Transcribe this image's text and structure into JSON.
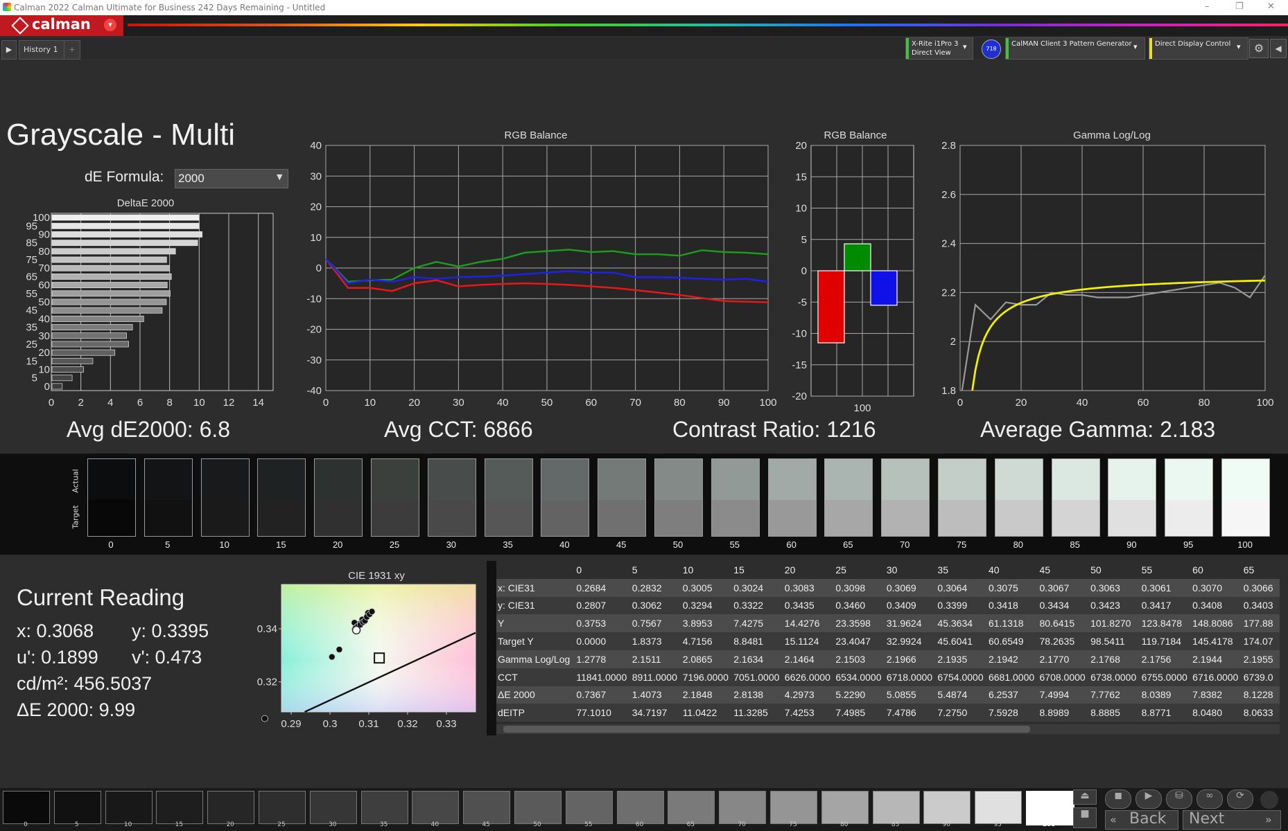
{
  "window": {
    "title": "Calman 2022 Calman Ultimate for Business 242 Days Remaining  - Untitled",
    "minimize": "–",
    "restore": "❐",
    "close": "✕"
  },
  "logo": {
    "text": "calman",
    "brand_color": "#c0191f"
  },
  "tabs": [
    {
      "label": "History 1"
    },
    {
      "label": "+"
    }
  ],
  "devices": [
    {
      "line1": "X-Rite i1Pro 3",
      "line2": "Direct View",
      "color": "#3ec43e"
    },
    {
      "badge": "718"
    },
    {
      "line1": "CalMAN Client 3 Pattern Generator",
      "line2": "",
      "color": "#3ec43e"
    },
    {
      "line1": "Direct Display Control",
      "line2": "",
      "color": "#e8e020"
    }
  ],
  "page": {
    "title": "Grayscale - Multi",
    "de_formula_label": "dE Formula:",
    "de_formula_value": "2000"
  },
  "stats": {
    "avg_de": "Avg dE2000: 6.8",
    "avg_cct": "Avg CCT: 6866",
    "contrast": "Contrast Ratio: 1216",
    "avg_gamma": "Average Gamma: 2.183"
  },
  "chart_data": [
    {
      "id": "deltae",
      "type": "bar",
      "title": "DeltaE 2000",
      "orientation": "horizontal",
      "categories": [
        0,
        5,
        10,
        15,
        20,
        25,
        30,
        35,
        40,
        45,
        50,
        55,
        60,
        65,
        70,
        75,
        80,
        85,
        90,
        95,
        100
      ],
      "values": [
        0.74,
        1.41,
        2.18,
        2.81,
        4.3,
        5.23,
        5.09,
        5.49,
        6.25,
        7.5,
        7.78,
        8.04,
        7.84,
        8.12,
        8.0,
        7.8,
        8.4,
        9.9,
        10.2,
        10.0,
        9.99
      ],
      "y_tick_labels": [
        0,
        5,
        10,
        15,
        20,
        25,
        30,
        35,
        40,
        45,
        50,
        55,
        60,
        65,
        70,
        75,
        80,
        85,
        90,
        95,
        100
      ],
      "x_ticks": [
        0,
        2,
        4,
        6,
        8,
        10,
        12,
        14
      ],
      "xlim": [
        0,
        15
      ]
    },
    {
      "id": "rgb-line",
      "type": "line",
      "title": "RGB Balance",
      "x": [
        0,
        5,
        10,
        15,
        20,
        25,
        30,
        35,
        40,
        45,
        50,
        55,
        60,
        65,
        70,
        75,
        80,
        85,
        90,
        95,
        100
      ],
      "series": [
        {
          "color": "#e81818",
          "values": [
            3,
            -6.5,
            -6.5,
            -7.5,
            -5,
            -4,
            -6,
            -5.5,
            -5.2,
            -5,
            -5.2,
            -5.5,
            -6,
            -6.5,
            -7.2,
            -8,
            -8.8,
            -9.8,
            -10.8,
            -11,
            -11.2
          ]
        },
        {
          "color": "#1e9a1e",
          "values": [
            3,
            -4.5,
            -4,
            -3.8,
            0,
            2,
            0.5,
            2,
            3,
            5,
            5.5,
            6,
            5.2,
            5.5,
            4.5,
            4.5,
            4,
            5.8,
            5.2,
            5,
            4.5
          ]
        },
        {
          "color": "#2020ee",
          "values": [
            3,
            -5,
            -3.8,
            -4.5,
            -3,
            -3.5,
            -3,
            -2.8,
            -2.5,
            -2,
            -1.5,
            -1,
            -1.5,
            -1.5,
            -3,
            -3,
            -3.2,
            -3.5,
            -3.8,
            -3.5,
            -4.5
          ]
        }
      ],
      "x_ticks": [
        0,
        10,
        20,
        30,
        40,
        50,
        60,
        70,
        80,
        90,
        100
      ],
      "y_ticks": [
        40,
        30,
        20,
        10,
        0,
        -10,
        -20,
        -30,
        -40
      ],
      "ylim": [
        -40,
        40
      ]
    },
    {
      "id": "rgb-bar",
      "type": "bar",
      "title": "RGB Balance",
      "categories": [
        "100"
      ],
      "series": [
        {
          "color": "#e00000",
          "values": [
            -11.5
          ]
        },
        {
          "color": "#008a00",
          "values": [
            4.3
          ]
        },
        {
          "color": "#1010e8",
          "values": [
            -5.5
          ]
        }
      ],
      "y_ticks": [
        20,
        15,
        10,
        5,
        0,
        -5,
        -10,
        -15,
        -20
      ],
      "ylim": [
        -20,
        20
      ]
    },
    {
      "id": "gamma",
      "type": "line",
      "title": "Gamma Log/Log",
      "x": [
        0,
        5,
        10,
        15,
        20,
        25,
        30,
        35,
        40,
        45,
        50,
        55,
        60,
        65,
        70,
        75,
        80,
        85,
        90,
        95,
        100
      ],
      "series": [
        {
          "color": "#9a9a9a",
          "values": [
            1.28,
            2.15,
            2.09,
            2.16,
            2.15,
            2.15,
            2.2,
            2.19,
            2.19,
            2.18,
            2.18,
            2.18,
            2.19,
            2.2,
            2.21,
            2.22,
            2.23,
            2.24,
            2.22,
            2.18,
            2.27
          ]
        },
        {
          "color": "#f2f200",
          "values": [
            1.8,
            1.8,
            1.93,
            2.04,
            2.1,
            2.14,
            2.17,
            2.19,
            2.205,
            2.215,
            2.225,
            2.232,
            2.239,
            2.245,
            2.25,
            2.255,
            2.26,
            2.264,
            2.268,
            2.272,
            2.276
          ]
        }
      ],
      "x_ticks": [
        0,
        20,
        40,
        60,
        80,
        100
      ],
      "y_ticks": [
        2.8,
        2.6,
        2.4,
        2.2,
        2,
        1.8
      ],
      "y_tick_labels": [
        "2.8",
        "2.6",
        "2.4",
        "2.2",
        "2",
        "1.8"
      ],
      "ylim": [
        1.8,
        2.8
      ]
    },
    {
      "id": "cie",
      "type": "scatter",
      "title": "CIE 1931 xy",
      "x_ticks": [
        0.29,
        0.3,
        0.31,
        0.32,
        0.33
      ],
      "y_ticks": [
        0.34,
        0.32
      ],
      "xlim": [
        0.2875,
        0.3375
      ],
      "ylim": [
        0.3087,
        0.3567
      ],
      "points": [
        [
          0.2832,
          0.3062
        ],
        [
          0.3005,
          0.3294
        ],
        [
          0.3024,
          0.3322
        ],
        [
          0.3064,
          0.3399
        ],
        [
          0.3068,
          0.3395
        ],
        [
          0.3075,
          0.3418
        ],
        [
          0.3083,
          0.3435
        ],
        [
          0.3098,
          0.346
        ],
        [
          0.3069,
          0.3409
        ],
        [
          0.3063,
          0.3423
        ],
        [
          0.307,
          0.3408
        ],
        [
          0.3066,
          0.3403
        ],
        [
          0.3072,
          0.341
        ],
        [
          0.3078,
          0.3415
        ],
        [
          0.3085,
          0.3425
        ],
        [
          0.309,
          0.343
        ],
        [
          0.3095,
          0.3445
        ],
        [
          0.3102,
          0.3455
        ],
        [
          0.3108,
          0.3465
        ]
      ],
      "current": [
        0.3068,
        0.3395
      ],
      "target": [
        0.3127,
        0.329
      ]
    }
  ],
  "swatches": {
    "actual_label": "Actual",
    "target_label": "Target",
    "levels": [
      "0",
      "5",
      "10",
      "15",
      "20",
      "25",
      "30",
      "35",
      "40",
      "45",
      "50",
      "55",
      "60",
      "65",
      "70",
      "75",
      "80",
      "85",
      "90",
      "95",
      "100"
    ],
    "actual_colors": [
      "#0c0d0e",
      "#121415",
      "#181a1b",
      "#1e2223",
      "#2d3230",
      "#3b403d",
      "#484d4b",
      "#555b59",
      "#636968",
      "#737a77",
      "#838a87",
      "#929a97",
      "#a1aaa6",
      "#aab4b0",
      "#b6c1bb",
      "#c3cec8",
      "#cfdad4",
      "#dbe8e1",
      "#e5f3ec",
      "#ebf8f1",
      "#eefcf5"
    ],
    "target_colors": [
      "#080808",
      "#111111",
      "#1a1a1a",
      "#222222",
      "#303030",
      "#3c3c3c",
      "#494949",
      "#565656",
      "#636363",
      "#707070",
      "#7e7e7e",
      "#8b8b8b",
      "#999999",
      "#a7a7a7",
      "#b2b2b2",
      "#bdbdbd",
      "#c9c9c9",
      "#d4d4d4",
      "#e0e0e0",
      "#ececec",
      "#f6f6f6"
    ]
  },
  "current_reading": {
    "title": "Current Reading",
    "x": "x: 0.3068",
    "y": "y: 0.3395",
    "u": "u': 0.1899",
    "v": "v': 0.473",
    "cd": "cd/m²: 456.5037",
    "de": "ΔE 2000: 9.99"
  },
  "table": {
    "columns": [
      "0",
      "5",
      "10",
      "15",
      "20",
      "25",
      "30",
      "35",
      "40",
      "45",
      "50",
      "55",
      "60",
      "65"
    ],
    "rows": [
      {
        "label": "x: CIE31",
        "cells": [
          "0.2684",
          "0.2832",
          "0.3005",
          "0.3024",
          "0.3083",
          "0.3098",
          "0.3069",
          "0.3064",
          "0.3075",
          "0.3067",
          "0.3063",
          "0.3061",
          "0.3070",
          "0.3066"
        ]
      },
      {
        "label": "y: CIE31",
        "cells": [
          "0.2807",
          "0.3062",
          "0.3294",
          "0.3322",
          "0.3435",
          "0.3460",
          "0.3409",
          "0.3399",
          "0.3418",
          "0.3434",
          "0.3423",
          "0.3417",
          "0.3408",
          "0.3403"
        ]
      },
      {
        "label": "Y",
        "cells": [
          "0.3753",
          "0.7567",
          "3.8953",
          "7.4275",
          "14.4276",
          "23.3598",
          "31.9624",
          "45.3634",
          "61.1318",
          "80.6415",
          "101.8270",
          "123.8478",
          "148.8086",
          "177.88"
        ]
      },
      {
        "label": "Target Y",
        "cells": [
          "0.0000",
          "1.8373",
          "4.7156",
          "8.8481",
          "15.1124",
          "23.4047",
          "32.9924",
          "45.6041",
          "60.6549",
          "78.2635",
          "98.5411",
          "119.7184",
          "145.4178",
          "174.07"
        ]
      },
      {
        "label": "Gamma Log/Log",
        "cells": [
          "1.2778",
          "2.1511",
          "2.0865",
          "2.1634",
          "2.1464",
          "2.1503",
          "2.1966",
          "2.1935",
          "2.1942",
          "2.1770",
          "2.1768",
          "2.1756",
          "2.1944",
          "2.1955"
        ]
      },
      {
        "label": "CCT",
        "cells": [
          "11841.0000",
          "8911.0000",
          "7196.0000",
          "7051.0000",
          "6626.0000",
          "6534.0000",
          "6718.0000",
          "6754.0000",
          "6681.0000",
          "6708.0000",
          "6738.0000",
          "6755.0000",
          "6716.0000",
          "6739.0"
        ]
      },
      {
        "label": "ΔE 2000",
        "cells": [
          "0.7367",
          "1.4073",
          "2.1848",
          "2.8138",
          "4.2973",
          "5.2290",
          "5.0855",
          "5.4874",
          "6.2537",
          "7.4994",
          "7.7762",
          "8.0389",
          "7.8382",
          "8.1228"
        ]
      },
      {
        "label": "dEITP",
        "cells": [
          "77.1010",
          "34.7197",
          "11.0422",
          "11.3285",
          "7.4253",
          "7.4985",
          "7.4786",
          "7.2750",
          "7.5928",
          "8.8989",
          "8.8885",
          "8.8771",
          "8.0480",
          "8.0633"
        ]
      }
    ]
  },
  "bottom": {
    "levels": [
      "0",
      "5",
      "10",
      "15",
      "20",
      "25",
      "30",
      "35",
      "40",
      "45",
      "50",
      "55",
      "60",
      "65",
      "70",
      "75",
      "80",
      "85",
      "90",
      "95",
      "100"
    ],
    "colors": [
      "#0a0a0a",
      "#111111",
      "#181818",
      "#1e1e1e",
      "#262626",
      "#2e2e2e",
      "#363636",
      "#3e3e3e",
      "#474747",
      "#505050",
      "#5a5a5a",
      "#646464",
      "#6e6e6e",
      "#7a7a7a",
      "#878787",
      "#959595",
      "#a5a5a5",
      "#b7b7b7",
      "#cbcbcb",
      "#e0e0e0",
      "#ffffff"
    ],
    "back_label": "Back",
    "next_label": "Next"
  }
}
